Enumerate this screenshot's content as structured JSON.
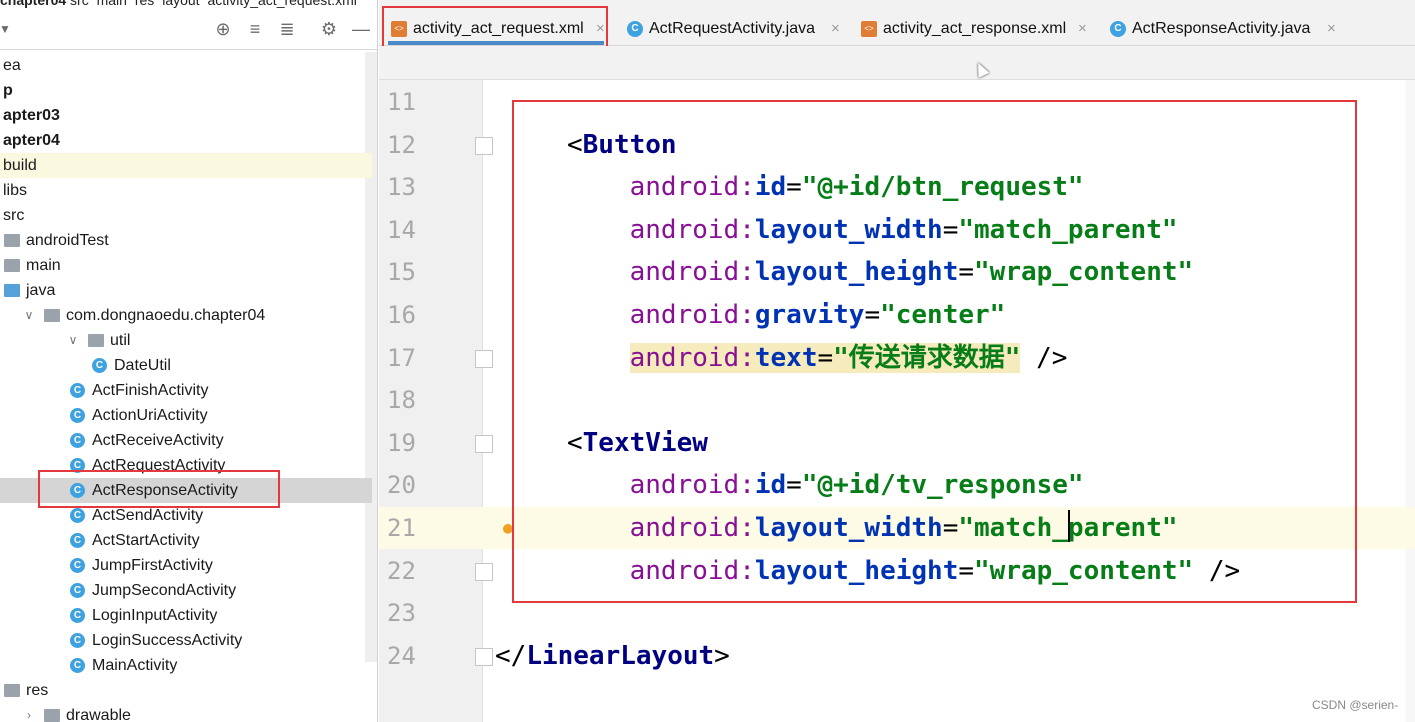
{
  "breadcrumb": [
    "chapter04",
    "src",
    "main",
    "res",
    "layout",
    "activity_act_request.xml"
  ],
  "project_tree": [
    {
      "label": "ea",
      "indent": 0,
      "bold": false
    },
    {
      "label": "p",
      "indent": 0,
      "bold": true
    },
    {
      "label": "apter03",
      "indent": 0,
      "bold": true
    },
    {
      "label": "apter04",
      "indent": 0,
      "bold": true
    },
    {
      "label": "build",
      "indent": 0,
      "bold": false
    },
    {
      "label": "libs",
      "indent": 0,
      "bold": false
    },
    {
      "label": "src",
      "indent": 0,
      "bold": false
    },
    {
      "label": "androidTest",
      "indent": 1,
      "bold": false
    },
    {
      "label": "main",
      "indent": 1,
      "bold": false
    },
    {
      "label": "java",
      "indent": 1,
      "bold": false
    },
    {
      "label": "com.dongnaoedu.chapter04",
      "indent": 2,
      "bold": false
    },
    {
      "label": "util",
      "indent": 3,
      "bold": false
    },
    {
      "label": "DateUtil",
      "indent": 4,
      "bold": false
    },
    {
      "label": "ActFinishActivity",
      "indent": 3,
      "bold": false
    },
    {
      "label": "ActionUriActivity",
      "indent": 3,
      "bold": false
    },
    {
      "label": "ActReceiveActivity",
      "indent": 3,
      "bold": false
    },
    {
      "label": "ActRequestActivity",
      "indent": 3,
      "bold": false
    },
    {
      "label": "ActResponseActivity",
      "indent": 3,
      "bold": false
    },
    {
      "label": "ActSendActivity",
      "indent": 3,
      "bold": false
    },
    {
      "label": "ActStartActivity",
      "indent": 3,
      "bold": false
    },
    {
      "label": "JumpFirstActivity",
      "indent": 3,
      "bold": false
    },
    {
      "label": "JumpSecondActivity",
      "indent": 3,
      "bold": false
    },
    {
      "label": "LoginInputActivity",
      "indent": 3,
      "bold": false
    },
    {
      "label": "LoginSuccessActivity",
      "indent": 3,
      "bold": false
    },
    {
      "label": "MainActivity",
      "indent": 3,
      "bold": false
    },
    {
      "label": "res",
      "indent": 1,
      "bold": false
    },
    {
      "label": "drawable",
      "indent": 2,
      "bold": false
    }
  ],
  "tabs": [
    {
      "label": "activity_act_request.xml",
      "kind": "xml",
      "active": true
    },
    {
      "label": "ActRequestActivity.java",
      "kind": "java",
      "active": false
    },
    {
      "label": "activity_act_response.xml",
      "kind": "xml",
      "active": false
    },
    {
      "label": "ActResponseActivity.java",
      "kind": "java",
      "active": false
    }
  ],
  "code_lines": [
    {
      "n": "11",
      "tokens": []
    },
    {
      "n": "12",
      "tokens": [
        [
          "br",
          "<"
        ],
        [
          "tag",
          "Button"
        ]
      ]
    },
    {
      "n": "13",
      "tokens": [
        [
          "sp",
          "    "
        ],
        [
          "ns",
          "android:"
        ],
        [
          "attr",
          "id"
        ],
        [
          "eq",
          "="
        ],
        [
          "val",
          "\"@+id/btn_request\""
        ]
      ]
    },
    {
      "n": "14",
      "tokens": [
        [
          "sp",
          "    "
        ],
        [
          "ns",
          "android:"
        ],
        [
          "attr",
          "layout_width"
        ],
        [
          "eq",
          "="
        ],
        [
          "val",
          "\"match_parent\""
        ]
      ]
    },
    {
      "n": "15",
      "tokens": [
        [
          "sp",
          "    "
        ],
        [
          "ns",
          "android:"
        ],
        [
          "attr",
          "layout_height"
        ],
        [
          "eq",
          "="
        ],
        [
          "val",
          "\"wrap_content\""
        ]
      ]
    },
    {
      "n": "16",
      "tokens": [
        [
          "sp",
          "    "
        ],
        [
          "ns",
          "android:"
        ],
        [
          "attr",
          "gravity"
        ],
        [
          "eq",
          "="
        ],
        [
          "val",
          "\"center\""
        ]
      ]
    },
    {
      "n": "17",
      "tokens": [
        [
          "sp",
          "    "
        ],
        [
          "ns",
          "android:"
        ],
        [
          "attr",
          "text"
        ],
        [
          "eq",
          "="
        ],
        [
          "val",
          "\"传送请求数据\""
        ],
        [
          "br",
          " />"
        ]
      ]
    },
    {
      "n": "18",
      "tokens": []
    },
    {
      "n": "19",
      "tokens": [
        [
          "br",
          "<"
        ],
        [
          "tag",
          "TextView"
        ]
      ]
    },
    {
      "n": "20",
      "tokens": [
        [
          "sp",
          "    "
        ],
        [
          "ns",
          "android:"
        ],
        [
          "attr",
          "id"
        ],
        [
          "eq",
          "="
        ],
        [
          "val",
          "\"@+id/tv_response\""
        ]
      ]
    },
    {
      "n": "21",
      "tokens": [
        [
          "sp",
          "    "
        ],
        [
          "ns",
          "android:"
        ],
        [
          "attr",
          "layout_width"
        ],
        [
          "eq",
          "="
        ],
        [
          "val",
          "\"match_parent\""
        ]
      ]
    },
    {
      "n": "22",
      "tokens": [
        [
          "sp",
          "    "
        ],
        [
          "ns",
          "android:"
        ],
        [
          "attr",
          "layout_height"
        ],
        [
          "eq",
          "="
        ],
        [
          "val",
          "\"wrap_content\""
        ],
        [
          "br",
          " />"
        ]
      ]
    },
    {
      "n": "23",
      "tokens": []
    },
    {
      "n": "24",
      "tokens": [
        [
          "br",
          "</"
        ],
        [
          "tag",
          "LinearLayout"
        ],
        [
          "br",
          ">"
        ]
      ]
    }
  ],
  "watermark": "CSDN @serien-",
  "colors": {
    "highlight_box": "#e4393c",
    "tab_active_underline": "#4a88c7",
    "xml_tag": "#000080",
    "xml_attr": "#0033b3",
    "xml_ns": "#871094",
    "xml_value": "#067d17"
  }
}
